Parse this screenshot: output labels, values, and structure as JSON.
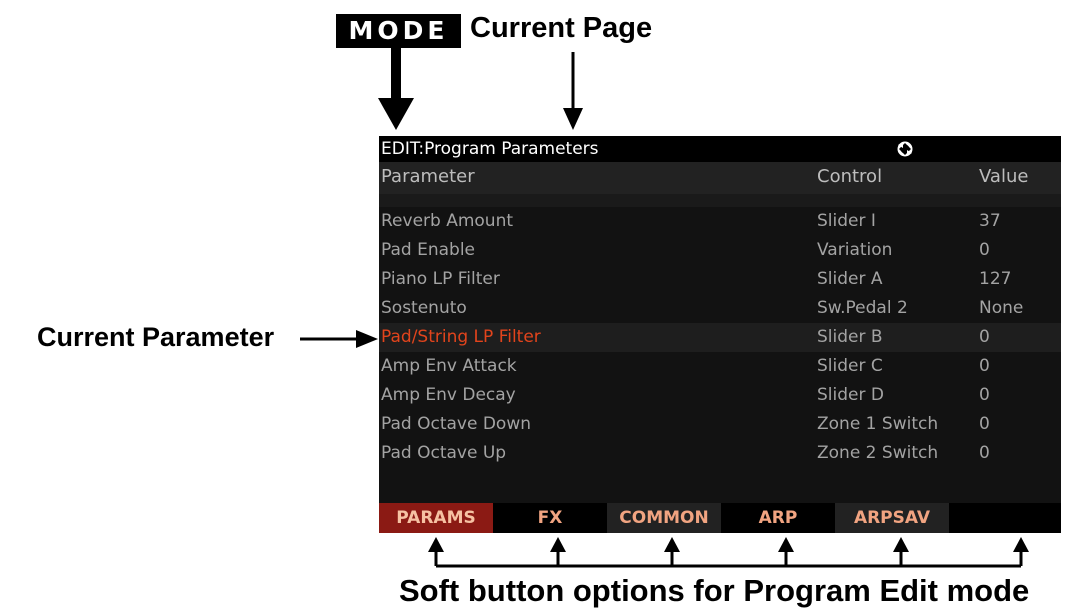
{
  "annotations": {
    "mode_label": "MODE",
    "current_page_label": "Current Page",
    "current_parameter_label": "Current Parameter",
    "soft_button_caption": "Soft button options for Program Edit mode"
  },
  "screen": {
    "title": "EDIT:Program Parameters",
    "icon": "sync-icon",
    "columns": {
      "parameter": "Parameter",
      "control": "Control",
      "value": "Value"
    },
    "rows": [
      {
        "parameter": "Reverb Amount",
        "control": "Slider I",
        "value": "37"
      },
      {
        "parameter": "Pad Enable",
        "control": "Variation",
        "value": "0"
      },
      {
        "parameter": "Piano LP Filter",
        "control": "Slider A",
        "value": "127"
      },
      {
        "parameter": "Sostenuto",
        "control": "Sw.Pedal 2",
        "value": "None"
      },
      {
        "parameter": "Pad/String LP Filter",
        "control": "Slider B",
        "value": "0"
      },
      {
        "parameter": "Amp Env Attack",
        "control": "Slider C",
        "value": "0"
      },
      {
        "parameter": "Amp Env Decay",
        "control": "Slider D",
        "value": "0"
      },
      {
        "parameter": "Pad Octave Down",
        "control": "Zone 1 Switch",
        "value": "0"
      },
      {
        "parameter": "Pad Octave Up",
        "control": "Zone 2 Switch",
        "value": "0"
      }
    ],
    "current_row_index": 4,
    "soft_buttons": [
      "PARAMS",
      "FX",
      "COMMON",
      "ARP",
      "ARPSAV",
      ""
    ],
    "active_soft_button": "PARAMS"
  },
  "colors": {
    "highlight": "#e2441c",
    "active_tab": "#8b1a14",
    "tab_text": "#f1a481"
  }
}
